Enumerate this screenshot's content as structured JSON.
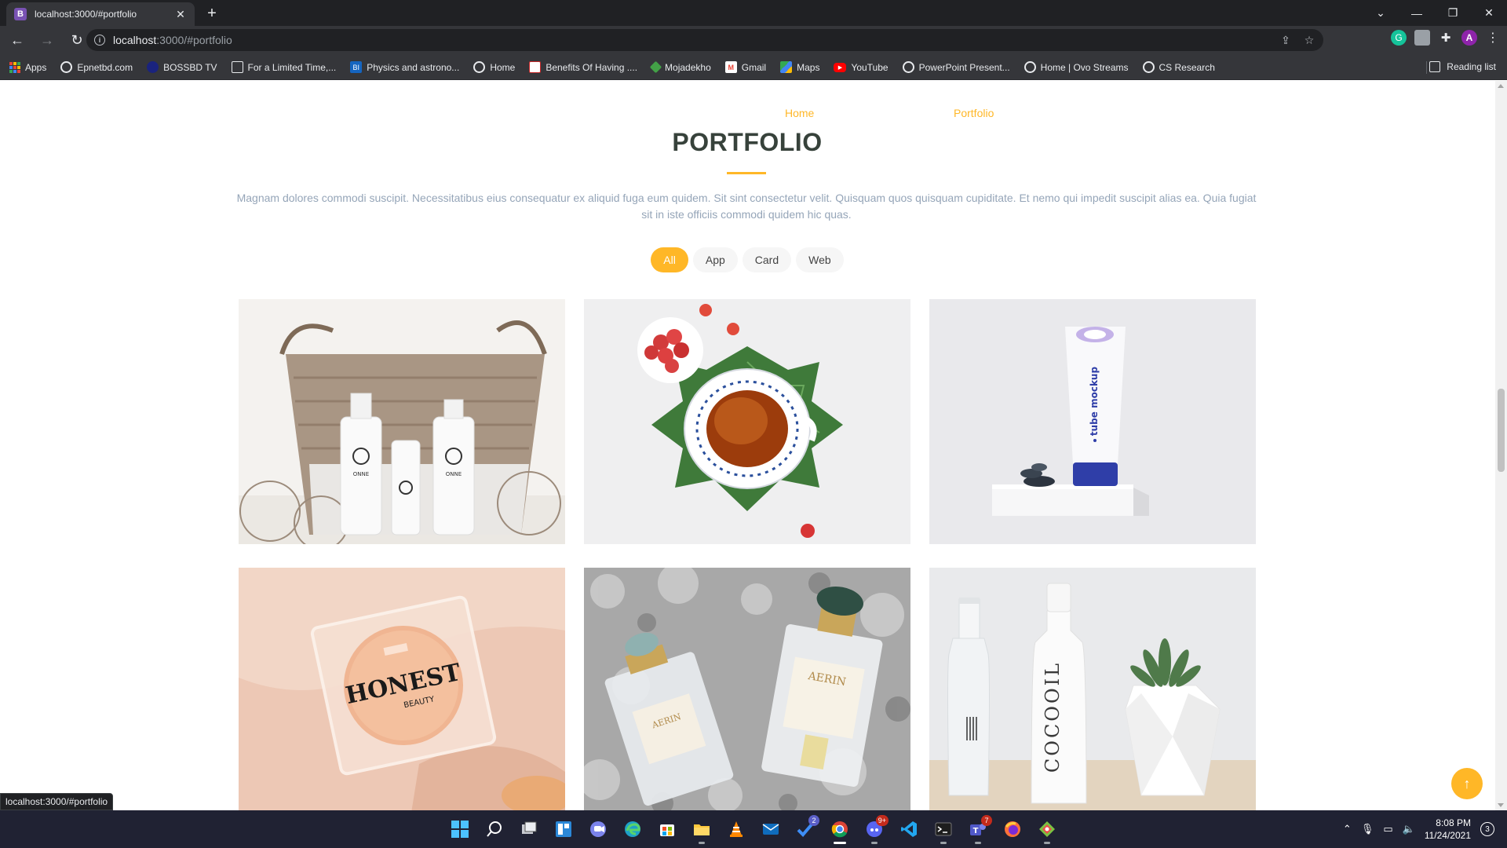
{
  "browser": {
    "tab_title": "localhost:3000/#portfolio",
    "tab_favicon_letter": "B",
    "url_host": "localhost",
    "url_path": ":3000/#portfolio",
    "profile_initial": "A",
    "status_url": "localhost:3000/#portfolio",
    "bookmarks": [
      {
        "label": "Apps",
        "icon": "apps-icon"
      },
      {
        "label": "Epnetbd.com",
        "icon": "globe-icon"
      },
      {
        "label": "BOSSBD TV",
        "icon": "bossbd-icon"
      },
      {
        "label": "For a Limited Time,...",
        "icon": "page-icon"
      },
      {
        "label": "Physics and astrono...",
        "icon": "bi-icon"
      },
      {
        "label": "Home",
        "icon": "globe-icon"
      },
      {
        "label": "Benefits Of Having ....",
        "icon": "page-icon"
      },
      {
        "label": "Mojadekho",
        "icon": "diamond-icon"
      },
      {
        "label": "Gmail",
        "icon": "gmail-icon"
      },
      {
        "label": "Maps",
        "icon": "maps-icon"
      },
      {
        "label": "YouTube",
        "icon": "youtube-icon"
      },
      {
        "label": "PowerPoint Present...",
        "icon": "globe-icon"
      },
      {
        "label": "Home | Ovo Streams",
        "icon": "globe-icon"
      },
      {
        "label": "CS Research",
        "icon": "globe-icon"
      }
    ],
    "reading_list": "Reading list"
  },
  "page": {
    "breadcrumb_home": "Home",
    "breadcrumb_current": "Portfolio",
    "title": "PORTFOLIO",
    "description": "Magnam dolores commodi suscipit. Necessitatibus eius consequatur ex aliquid fuga eum quidem. Sit sint consectetur velit. Quisquam quos quisquam cupiditate. Et nemo qui impedit suscipit alias ea. Quia fugiat sit in iste officiis commodi quidem hic quas.",
    "filters": [
      "All",
      "App",
      "Card",
      "Web"
    ],
    "active_filter": "All",
    "accent_color": "#ffb727",
    "portfolio_items": [
      {
        "name": "basket-cosmetics",
        "brand_text": "ONNE"
      },
      {
        "name": "tea-cup"
      },
      {
        "name": "tube-mockup",
        "brand_text": "tube mockup"
      },
      {
        "name": "honest-beauty",
        "brand_text": "HONEST",
        "brand_sub": "BEAUTY"
      },
      {
        "name": "aerin-perfume",
        "brand_text": "AERIN"
      },
      {
        "name": "cocooil-bottle",
        "brand_text": "COCOOIL"
      }
    ]
  },
  "taskbar": {
    "time": "8:08 PM",
    "date": "11/24/2021",
    "notification_count": "3",
    "badges": {
      "todo": "2",
      "discord": "9+",
      "teams": "7"
    }
  }
}
